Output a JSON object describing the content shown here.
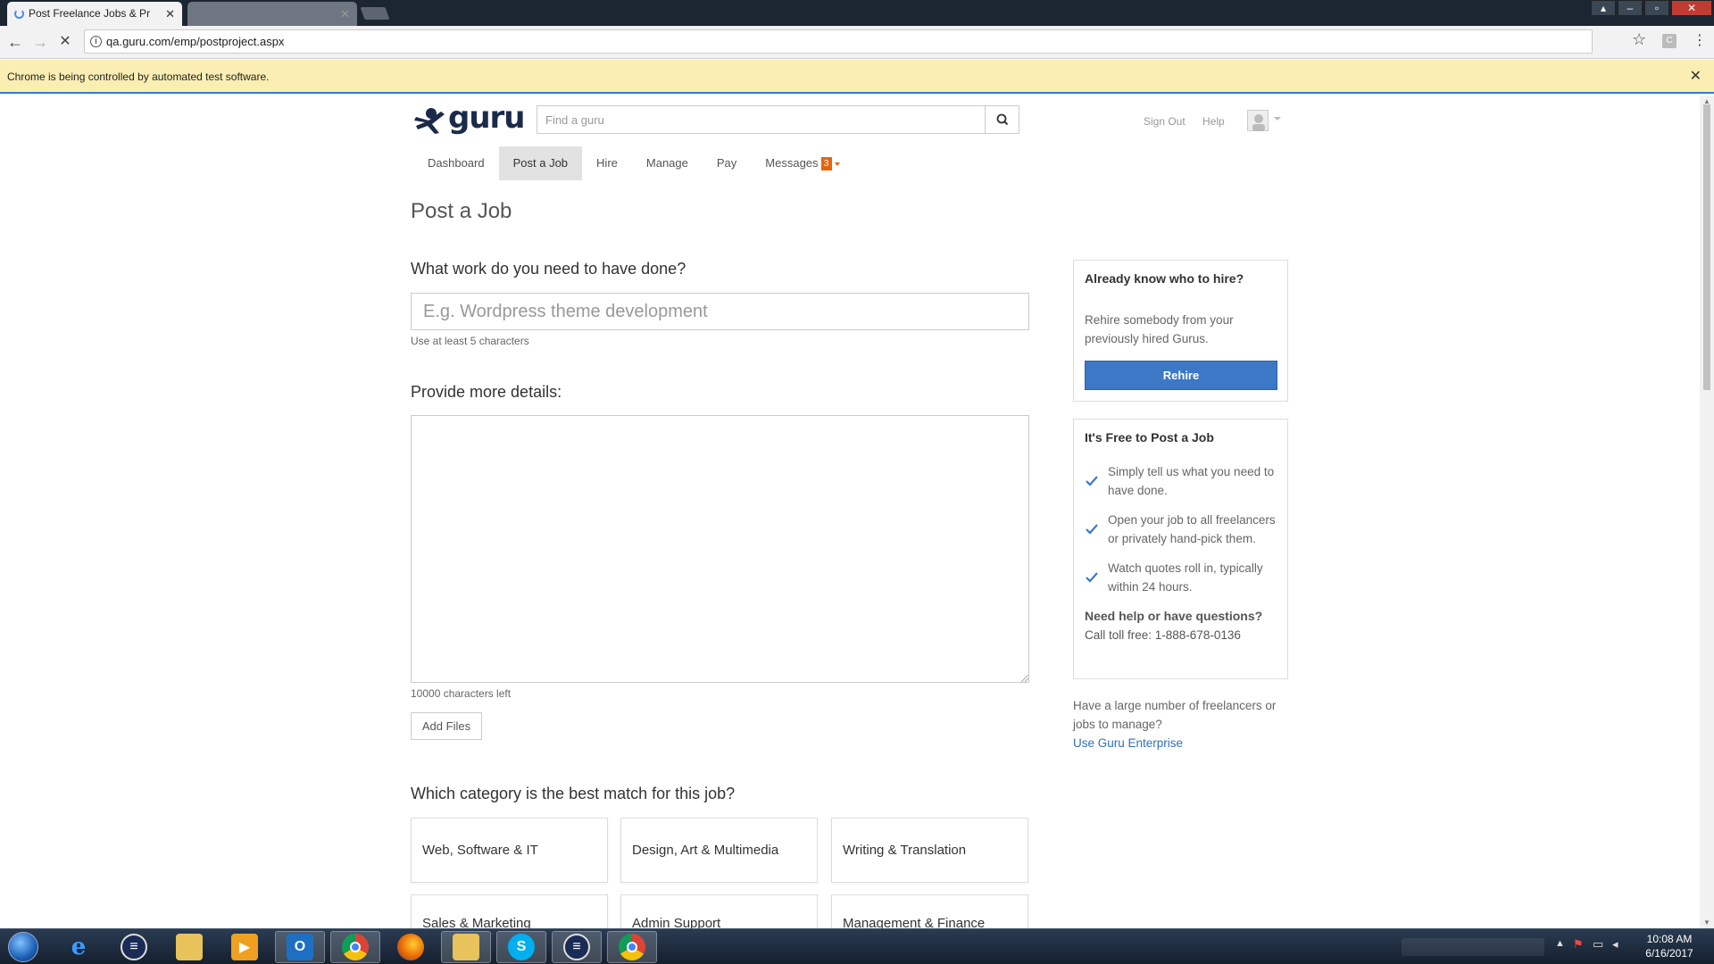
{
  "browser": {
    "active_tab_title": "Post Freelance Jobs & Pr",
    "inactive_tab_title": "",
    "url": "qa.guru.com/emp/postproject.aspx",
    "infobar_text": "Chrome is being controlled by automated test software."
  },
  "header": {
    "logo_text": "guru",
    "search_placeholder": "Find a guru",
    "sign_out": "Sign Out",
    "help": "Help"
  },
  "nav": {
    "items": [
      {
        "label": "Dashboard"
      },
      {
        "label": "Post a Job",
        "active": true
      },
      {
        "label": "Hire"
      },
      {
        "label": "Manage"
      },
      {
        "label": "Pay"
      },
      {
        "label": "Messages",
        "badge": "3"
      }
    ]
  },
  "main": {
    "title": "Post a Job",
    "q_work": "What work do you need to have done?",
    "work_placeholder": "E.g. Wordpress theme development",
    "work_hint": "Use at least 5 characters",
    "q_details": "Provide more details:",
    "details_counter": "10000 characters left",
    "add_files": "Add Files",
    "q_category": "Which category is the best match for this job?",
    "categories": [
      "Web, Software & IT",
      "Design, Art & Multimedia",
      "Writing & Translation",
      "Sales & Marketing",
      "Admin Support",
      "Management & Finance"
    ]
  },
  "sidebar": {
    "rehire": {
      "title": "Already know who to hire?",
      "text": "Rehire somebody from your previously hired Gurus.",
      "button": "Rehire"
    },
    "free": {
      "title": "It's Free to Post a Job",
      "items": [
        "Simply tell us what you need to have done.",
        "Open your job to all freelancers or privately hand-pick them.",
        "Watch quotes roll in, typically within 24 hours."
      ],
      "help_q": "Need help or have questions?",
      "help_phone": "Call toll free: 1-888-678-0136"
    },
    "enterprise": {
      "text": "Have a large number of freelancers or jobs to manage?",
      "link": "Use Guru Enterprise"
    }
  },
  "taskbar": {
    "time": "10:08 AM",
    "date": "6/16/2017",
    "apps": [
      "internet-explorer-icon",
      "app-icon",
      "file-explorer-icon",
      "media-player-icon",
      "outlook-icon",
      "chrome-icon",
      "firefox-icon",
      "folder-icon",
      "skype-icon",
      "app-icon",
      "chrome-icon"
    ]
  },
  "colors": {
    "accent": "#3d78c7",
    "badge": "#e8640c",
    "infobar": "#fbeeb3",
    "link": "#2e6fbf"
  }
}
